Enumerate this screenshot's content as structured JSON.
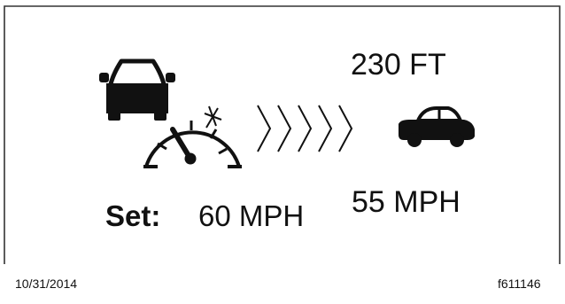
{
  "display": {
    "distance": "230 FT",
    "lead_vehicle_speed": "55 MPH",
    "set_label": "Set:",
    "set_speed": "60 MPH"
  },
  "footer": {
    "date": "10/31/2014",
    "figure_id": "f611146"
  },
  "icons": {
    "own_vehicle": "car-front-icon",
    "speedometer": "speedometer-icon",
    "following_gap": "chevron-right-icon",
    "lead_vehicle": "car-side-icon"
  },
  "colors": {
    "border": "#333333",
    "text": "#111111",
    "icon": "#111111",
    "background": "#ffffff"
  }
}
